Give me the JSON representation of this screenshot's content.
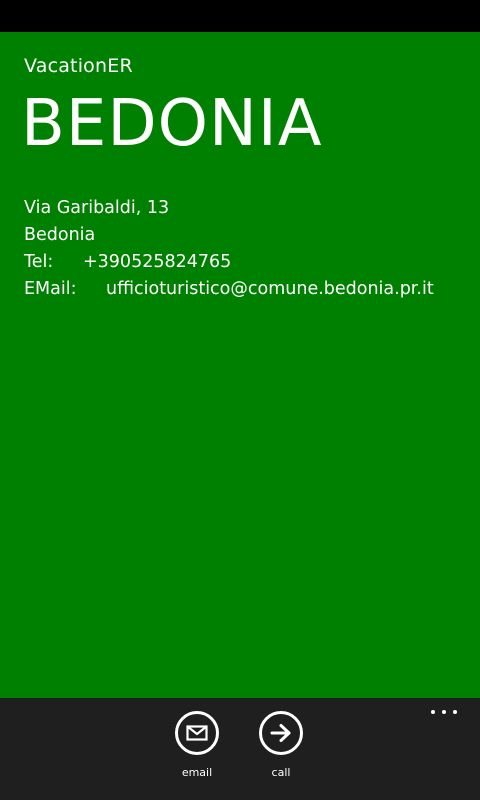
{
  "app": {
    "name": "VacationER",
    "page_title": "BEDONIA"
  },
  "contact": {
    "address": "Via Garibaldi, 13",
    "city": "Bedonia",
    "tel_label": "Tel:",
    "tel_value": "+390525824765",
    "email_label": "EMail:",
    "email_value": "ufficioturistico@comune.bedonia.pr.it"
  },
  "app_bar": {
    "buttons": [
      {
        "label": "email",
        "icon": "envelope-icon"
      },
      {
        "label": "call",
        "icon": "arrow-right-icon"
      }
    ],
    "more_icon": "ellipsis-icon"
  },
  "colors": {
    "accent": "#008000",
    "app_bar": "#1f1f1f",
    "status_bar": "#000000",
    "text": "#ffffff"
  }
}
